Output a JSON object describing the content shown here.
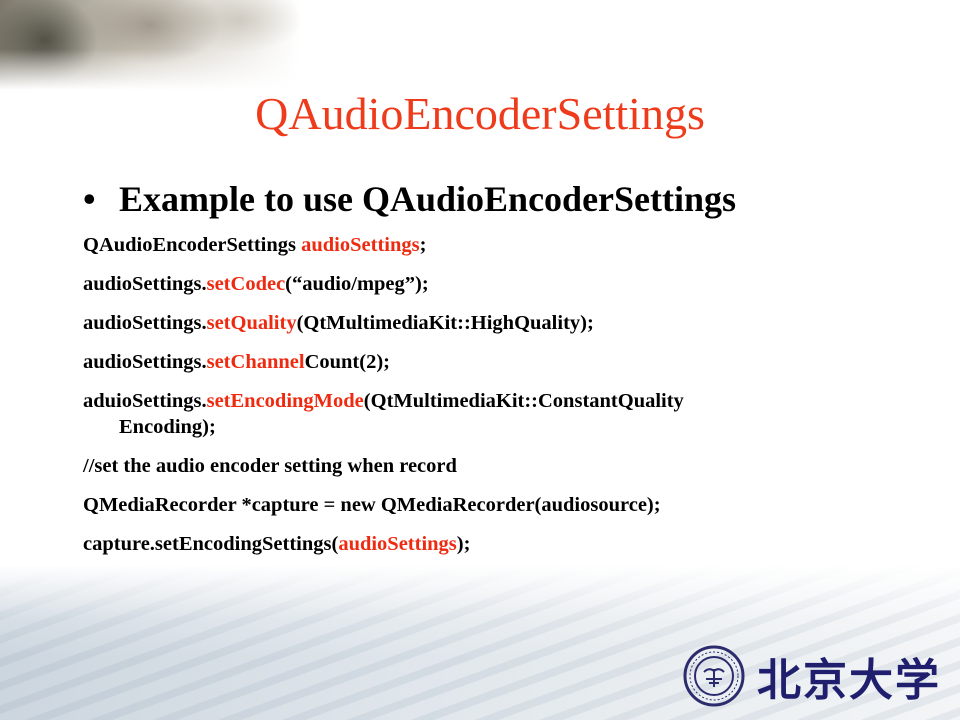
{
  "slide": {
    "title": "QAudioEncoderSettings",
    "bullet_marker": "•",
    "bullet_text": "Example to use QAudioEncoderSettings",
    "accent_color": "#ee3b1c",
    "logo_text": "北京大学"
  },
  "code": {
    "l1": {
      "a": "QAudioEncoderSettings ",
      "b": "audioSettings",
      "c": ";"
    },
    "l2": {
      "a": "audioSettings.",
      "b": "setCodec",
      "c": "(“audio/mpeg”);"
    },
    "l3": {
      "a": "audioSettings.",
      "b": "setQuality",
      "c": "(QtMultimediaKit::HighQuality);"
    },
    "l4": {
      "a": "audioSettings.",
      "b": "setChannel",
      "c": "Count(2);"
    },
    "l5": {
      "a": "aduioSettings.",
      "b": "setEncodingMode",
      "c": "(QtMultimediaKit::ConstantQuality",
      "d": "Encoding);"
    },
    "l6": {
      "a": "//set the audio encoder setting when record"
    },
    "l7": {
      "a": "QMediaRecorder *capture = new QMediaRecorder(audiosource);"
    },
    "l8": {
      "a": "capture.setEncodingSettings(",
      "b": "audioSettings",
      "c": ");"
    }
  }
}
